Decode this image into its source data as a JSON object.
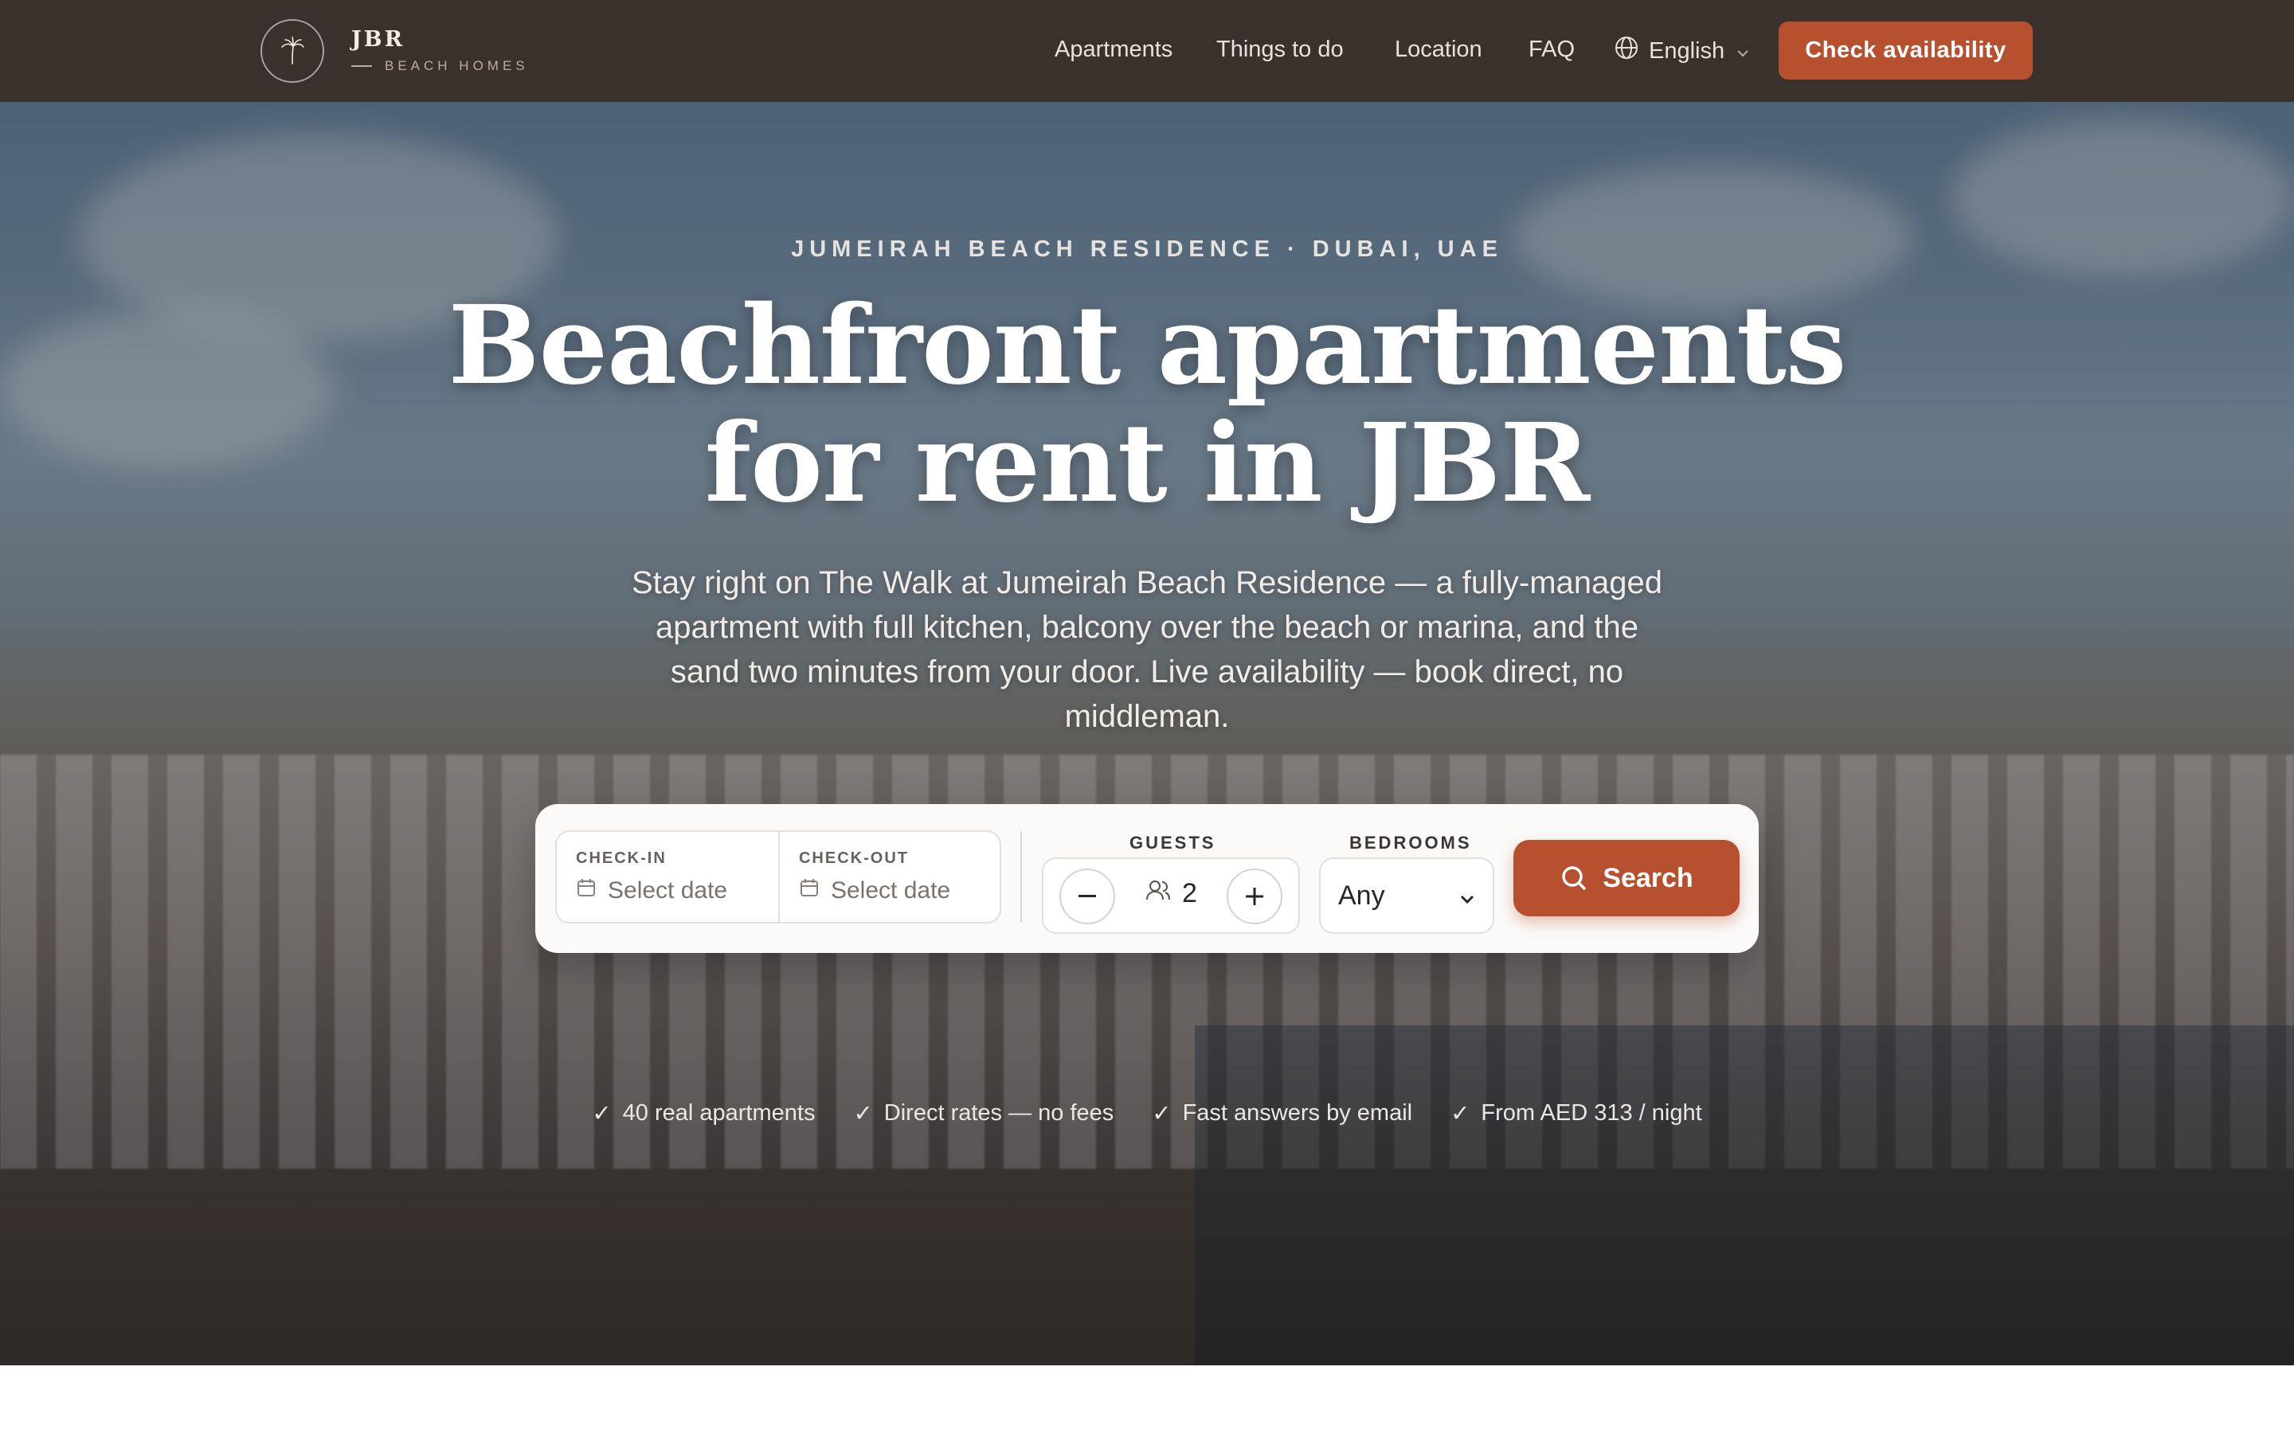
{
  "brand": {
    "name": "JBR",
    "tagline": "BEACH HOMES"
  },
  "nav": {
    "links": [
      "Apartments",
      "Things to do",
      "Location",
      "FAQ"
    ],
    "language": "English",
    "cta_label": "Check availability"
  },
  "hero": {
    "eyebrow": "JUMEIRAH BEACH RESIDENCE · DUBAI, UAE",
    "title_line1": "Beachfront apartments",
    "title_line2": "for rent in JBR",
    "subtitle": "Stay right on The Walk at Jumeirah Beach Residence — a fully-managed apartment with full kitchen, balcony over the beach or marina, and the sand two minutes from your door. Live availability — book direct, no middleman."
  },
  "search": {
    "checkin_label": "CHECK-IN",
    "checkin_value": "Select date",
    "checkout_label": "CHECK-OUT",
    "checkout_value": "Select date",
    "guests_label": "GUESTS",
    "guests_value": "2",
    "bedrooms_label": "BEDROOMS",
    "bedrooms_value": "Any",
    "search_label": "Search"
  },
  "trust": [
    "40 real apartments",
    "Direct rates — no fees",
    "Fast answers by email",
    "From AED 313 / night"
  ],
  "colors": {
    "accent": "#b7502e",
    "header_bg": "#3a312d"
  }
}
